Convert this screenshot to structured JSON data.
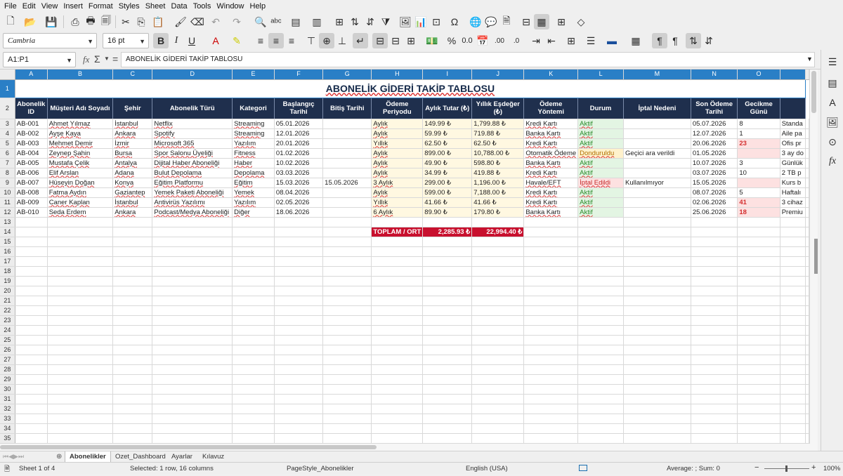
{
  "menu": [
    "File",
    "Edit",
    "View",
    "Insert",
    "Format",
    "Styles",
    "Sheet",
    "Data",
    "Tools",
    "Window",
    "Help"
  ],
  "font": {
    "name": "Cambria",
    "size": "16 pt"
  },
  "name_box": "A1:P1",
  "formula": "ABONELİK GİDERİ TAKİP TABLOSU",
  "columns": [
    "A",
    "B",
    "C",
    "D",
    "E",
    "F",
    "G",
    "H",
    "I",
    "J",
    "K",
    "L",
    "M",
    "N",
    "O",
    ""
  ],
  "title": "ABONELİK GİDERİ TAKİP TABLOSU",
  "headers": [
    "Abonelik ID",
    "Müşteri Adı Soyadı",
    "Şehir",
    "Abonelik Türü",
    "Kategori",
    "Başlangıç Tarihi",
    "Bitiş Tarihi",
    "Ödeme Periyodu",
    "Aylık Tutar (₺)",
    "Yıllık Eşdeğer (₺)",
    "Ödeme Yöntemi",
    "Durum",
    "İptal Nedeni",
    "Son Ödeme Tarihi",
    "Gecikme Günü",
    ""
  ],
  "rows": [
    [
      "AB-001",
      "Ahmet Yılmaz",
      "İstanbul",
      "Netflix",
      "Streaming",
      "05.01.2026",
      "",
      "Aylık",
      "149.99 ₺",
      "1,799.88 ₺",
      "Kredi Kartı",
      "Aktif",
      "",
      "05.07.2026",
      "8",
      "Standa"
    ],
    [
      "AB-002",
      "Ayşe Kaya",
      "Ankara",
      "Spotify",
      "Streaming",
      "12.01.2026",
      "",
      "Aylık",
      "59.99 ₺",
      "719.88 ₺",
      "Banka Kartı",
      "Aktif",
      "",
      "12.07.2026",
      "1",
      "Aile pa"
    ],
    [
      "AB-003",
      "Mehmet Demir",
      "İzmir",
      "Microsoft 365",
      "Yazılım",
      "20.01.2026",
      "",
      "Yıllık",
      "62.50 ₺",
      "62.50 ₺",
      "Kredi Kartı",
      "Aktif",
      "",
      "20.06.2026",
      "23",
      "Ofis pr"
    ],
    [
      "AB-004",
      "Zeynep Şahin",
      "Bursa",
      "Spor Salonu Üyeliği",
      "Fitness",
      "01.02.2026",
      "",
      "Aylık",
      "899.00 ₺",
      "10,788.00 ₺",
      "Otomatik Ödeme",
      "Donduruldu",
      "Geçici ara verildi",
      "01.05.2026",
      "",
      "3 ay do"
    ],
    [
      "AB-005",
      "Mustafa Çelik",
      "Antalya",
      "Dijital Haber Aboneliği",
      "Haber",
      "10.02.2026",
      "",
      "Aylık",
      "49.90 ₺",
      "598.80 ₺",
      "Banka Kartı",
      "Aktif",
      "",
      "10.07.2026",
      "3",
      "Günlük"
    ],
    [
      "AB-006",
      "Elif Arslan",
      "Adana",
      "Bulut Depolama",
      "Depolama",
      "03.03.2026",
      "",
      "Aylık",
      "34.99 ₺",
      "419.88 ₺",
      "Kredi Kartı",
      "Aktif",
      "",
      "03.07.2026",
      "10",
      "2 TB p"
    ],
    [
      "AB-007",
      "Hüseyin Doğan",
      "Konya",
      "Eğitim Platformu",
      "Eğitim",
      "15.03.2026",
      "15.05.2026",
      "3 Aylık",
      "299.00 ₺",
      "1,196.00 ₺",
      "Havale/EFT",
      "İptal Edildi",
      "Kullanılmıyor",
      "15.05.2026",
      "",
      "Kurs b"
    ],
    [
      "AB-008",
      "Fatma Aydın",
      "Gaziantep",
      "Yemek Paketi Aboneliği",
      "Yemek",
      "08.04.2026",
      "",
      "Aylık",
      "599.00 ₺",
      "7,188.00 ₺",
      "Kredi Kartı",
      "Aktif",
      "",
      "08.07.2026",
      "5",
      "Haftalı"
    ],
    [
      "AB-009",
      "Caner Kaplan",
      "İstanbul",
      "Antivirüs Yazılımı",
      "Yazılım",
      "02.05.2026",
      "",
      "Yıllık",
      "41.66 ₺",
      "41.66 ₺",
      "Kredi Kartı",
      "Aktif",
      "",
      "02.06.2026",
      "41",
      "3 cihaz"
    ],
    [
      "AB-010",
      "Seda Erdem",
      "Ankara",
      "Podcast/Medya Aboneliği",
      "Diğer",
      "18.06.2026",
      "",
      "6 Aylık",
      "89.90 ₺",
      "179.80 ₺",
      "Banka Kartı",
      "Aktif",
      "",
      "25.06.2026",
      "18",
      "Premiu"
    ]
  ],
  "total": {
    "label": "TOPLAM / ORT",
    "monthly": "2,285.93 ₺",
    "yearly": "22,994.40 ₺"
  },
  "row_numbers": [
    "1",
    "2",
    "3",
    "4",
    "5",
    "6",
    "7",
    "8",
    "9",
    "10",
    "11",
    "12",
    "13",
    "14",
    "15",
    "16",
    "17",
    "18",
    "19",
    "20",
    "21",
    "22",
    "23",
    "24",
    "25",
    "26",
    "27",
    "28",
    "29",
    "30",
    "31",
    "32",
    "33",
    "34",
    "35"
  ],
  "sheets": [
    "Abonelikler",
    "Ozet_Dashboard",
    "Ayarlar",
    "Kılavuz"
  ],
  "status": {
    "sheet": "Sheet 1 of 4",
    "selection": "Selected: 1 row, 16 columns",
    "pagestyle": "PageStyle_Abonelikler",
    "language": "English (USA)",
    "summary": "Average: ; Sum: 0",
    "zoom": "100%"
  },
  "colors": {
    "header_bg": "#1f2f4d",
    "total_bg": "#c8102e",
    "selection": "#2a7fc6"
  }
}
